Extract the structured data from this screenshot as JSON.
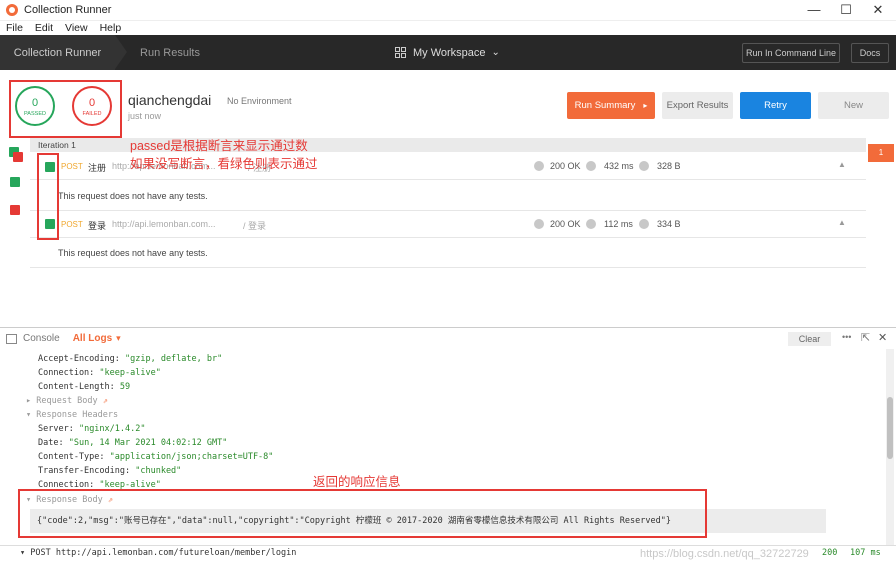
{
  "window": {
    "title": "Collection Runner",
    "minimize": "—",
    "maximize": "☐",
    "close": "✕"
  },
  "menu": [
    "File",
    "Edit",
    "View",
    "Help"
  ],
  "nav": {
    "crumb_runner": "Collection Runner",
    "crumb_results": "Run Results",
    "workspace": "My Workspace",
    "workspace_caret": "⌄",
    "run_cli": "Run In Command Line",
    "docs": "Docs"
  },
  "summary": {
    "passed_count": "0",
    "passed_label": "PASSED",
    "failed_count": "0",
    "failed_label": "FAILED",
    "collection": "qianchengdai",
    "environment": "No Environment",
    "time": "just now",
    "run_summary": "Run Summary",
    "run_summary_arrow": "▸",
    "export": "Export Results",
    "retry": "Retry",
    "new": "New"
  },
  "annotations": {
    "line1": "passed是根据断言来显示通过数",
    "line2": "如果没写断言，看绿色则表示通过",
    "response_note": "返回的响应信息"
  },
  "iteration": {
    "label": "Iteration 1",
    "tab_count": "1"
  },
  "requests": [
    {
      "method": "POST",
      "name": "注册",
      "url": "http://api.lemonban.com...",
      "path": "/ 注册",
      "status": "200 OK",
      "time": "432 ms",
      "size": "328 B",
      "caret": "▲",
      "tests": "This request does not have any tests."
    },
    {
      "method": "POST",
      "name": "登录",
      "url": "http://api.lemonban.com...",
      "path": "/ 登录",
      "status": "200 OK",
      "time": "112 ms",
      "size": "334 B",
      "caret": "▲",
      "tests": "This request does not have any tests."
    }
  ],
  "console": {
    "title": "Console",
    "filter": "All Logs",
    "filter_caret": "▾",
    "clear": "Clear",
    "more": "•••",
    "popout": "⇱",
    "close": "✕",
    "lines": [
      {
        "key": "Accept-Encoding: ",
        "val": "\"gzip, deflate, br\""
      },
      {
        "key": "Connection: ",
        "val": "\"keep-alive\""
      },
      {
        "key": "Content-Length: ",
        "val": "59"
      }
    ],
    "request_body": "▸ Request Body",
    "response_headers": "▾ Response Headers",
    "resp_lines": [
      {
        "key": "Server: ",
        "val": "\"nginx/1.4.2\""
      },
      {
        "key": "Date: ",
        "val": "\"Sun, 14 Mar 2021 04:02:12 GMT\""
      },
      {
        "key": "Content-Type: ",
        "val": "\"application/json;charset=UTF-8\""
      },
      {
        "key": "Transfer-Encoding: ",
        "val": "\"chunked\""
      },
      {
        "key": "Connection: ",
        "val": "\"keep-alive\""
      }
    ],
    "response_body": "▾ Response Body",
    "body_json": "{\"code\":2,\"msg\":\"账号已存在\",\"data\":null,\"copyright\":\"Copyright 柠檬班 © 2017-2020 湖南省零檬信息技术有限公司 All Rights Reserved\"}",
    "ext_icon": "⇗"
  },
  "footer": {
    "request": "▾ POST http://api.lemonban.com/futureloan/member/login",
    "status": "200",
    "time": "107 ms",
    "watermark": "https://blog.csdn.net/qq_32722729"
  }
}
